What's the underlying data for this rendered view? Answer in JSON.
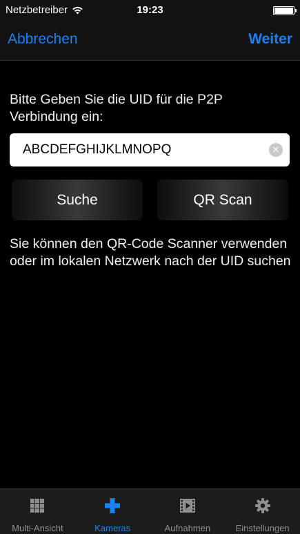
{
  "status": {
    "carrier": "Netzbetreiber",
    "time": "19:23",
    "battery_level": 1.0
  },
  "nav": {
    "cancel_label": "Abbrechen",
    "next_label": "Weiter"
  },
  "form": {
    "prompt": "Bitte Geben Sie die UID für die P2P Verbindung ein:",
    "uid_value": "ABCDEFGHIJKLMNOPQ",
    "search_label": "Suche",
    "qr_label": "QR Scan",
    "info": "Sie können den QR-Code Scanner verwenden oder im lokalen Netzwerk nach der UID suchen"
  },
  "tabs": [
    {
      "label": "Multi-Ansicht",
      "icon": "grid-icon",
      "active": false
    },
    {
      "label": "Kameras",
      "icon": "plus-icon",
      "active": true
    },
    {
      "label": "Aufnahmen",
      "icon": "film-icon",
      "active": false
    },
    {
      "label": "Einstellungen",
      "icon": "gear-icon",
      "active": false
    }
  ],
  "colors": {
    "accent": "#1a82f2",
    "background": "#000000",
    "bar": "#121212",
    "inactive_tab": "#8e8e93"
  }
}
